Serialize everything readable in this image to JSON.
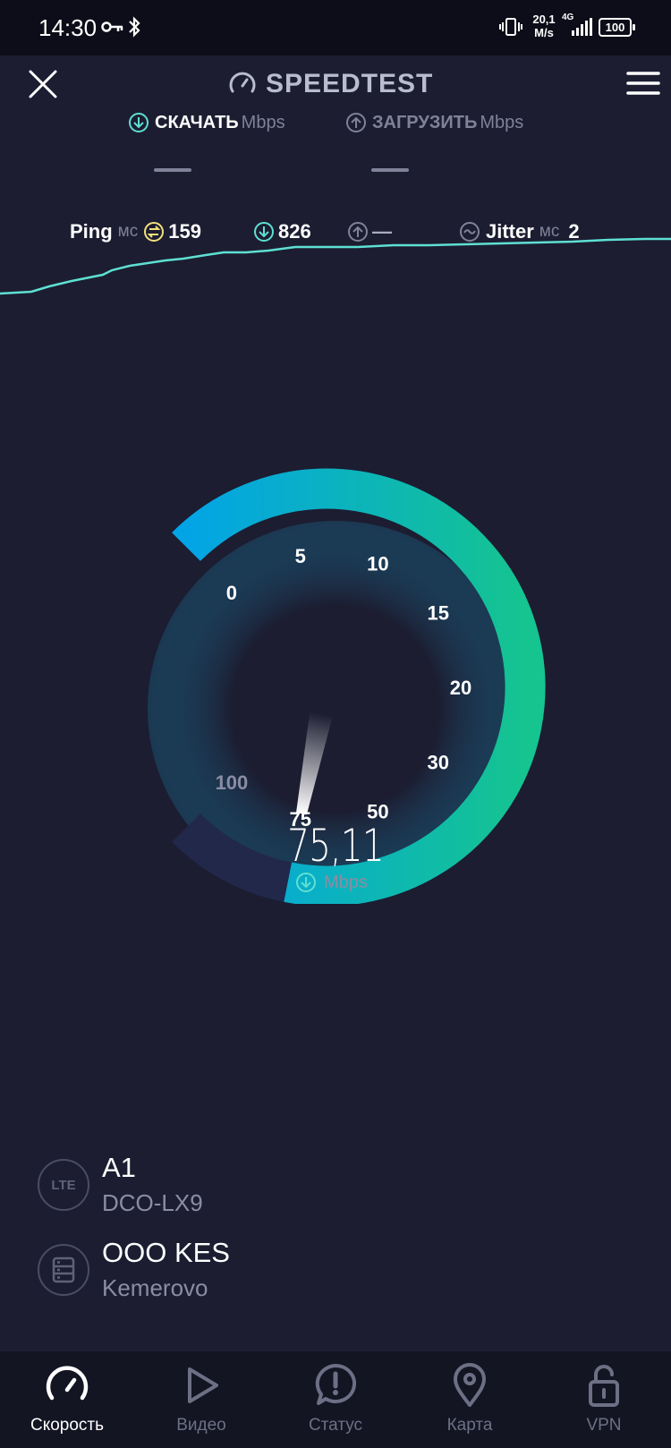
{
  "status_bar": {
    "time": "14:30",
    "speed_value": "20,1",
    "speed_unit": "M/s",
    "network": "4G",
    "battery": "100"
  },
  "header": {
    "title": "SPEEDTEST",
    "close_icon": "close-icon",
    "menu_icon": "hamburger-menu-icon"
  },
  "tabs": {
    "download": {
      "label": "СКАЧАТЬ",
      "unit": "Mbps",
      "value": "—"
    },
    "upload": {
      "label": "ЗАГРУЗИТЬ",
      "unit": "Mbps",
      "value": "—"
    }
  },
  "metrics": {
    "ping": {
      "label": "Ping",
      "unit": "мс",
      "value": "159"
    },
    "download_latency": {
      "value": "826"
    },
    "upload_latency": {
      "value": "—"
    },
    "jitter": {
      "label": "Jitter",
      "unit": "мс",
      "value": "2"
    }
  },
  "gauge": {
    "ticks": [
      "0",
      "5",
      "10",
      "15",
      "20",
      "30",
      "50",
      "75",
      "100"
    ],
    "current_value": "75,11",
    "unit": "Mbps",
    "needle_tick_fraction": 0.875,
    "fill_color_start": "#03a4e6",
    "fill_color_end": "#15c48f",
    "track_color": "#22284a"
  },
  "connection": {
    "isp_badge": "LTE",
    "isp_name": "A1",
    "device": "DCO-LX9",
    "server_name": "OOO KES",
    "server_city": "Kemerovo"
  },
  "bottom_nav": [
    {
      "label": "Скорость",
      "icon": "speedometer-icon",
      "active": true
    },
    {
      "label": "Видео",
      "icon": "play-icon",
      "active": false
    },
    {
      "label": "Статус",
      "icon": "alert-bubble-icon",
      "active": false
    },
    {
      "label": "Карта",
      "icon": "map-pin-icon",
      "active": false
    },
    {
      "label": "VPN",
      "icon": "unlock-icon",
      "active": false
    }
  ]
}
